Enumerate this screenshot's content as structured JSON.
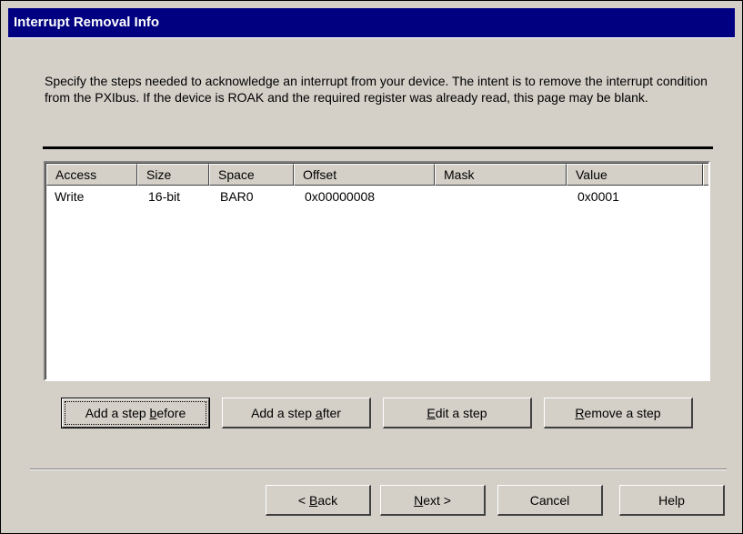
{
  "window": {
    "title": "Interrupt Removal Info"
  },
  "instructions": "Specify the steps needed to acknowledge an interrupt from your device.  The intent is to remove the interrupt condition from the PXIbus.  If the device is ROAK and the required register was already read, this page may be blank.",
  "table": {
    "columns": [
      "Access",
      "Size",
      "Space",
      "Offset",
      "Mask",
      "Value"
    ],
    "rows": [
      [
        "Write",
        "16-bit",
        "BAR0",
        "0x00000008",
        "",
        "0x0001"
      ]
    ]
  },
  "step_buttons": {
    "add_before": {
      "pre": "Add a step ",
      "mnemonic": "b",
      "post": "efore"
    },
    "add_after": {
      "pre": "Add a step ",
      "mnemonic": "a",
      "post": "fter"
    },
    "edit": {
      "pre": "",
      "mnemonic": "E",
      "post": "dit a step"
    },
    "remove": {
      "pre": "",
      "mnemonic": "R",
      "post": "emove a step"
    }
  },
  "nav_buttons": {
    "back": {
      "pre": "< ",
      "mnemonic": "B",
      "post": "ack"
    },
    "next": {
      "pre": "",
      "mnemonic": "N",
      "post": "ext >"
    },
    "cancel": "Cancel",
    "help": "Help"
  },
  "colors": {
    "titlebar": "#000080",
    "dialog_face": "#d4d0c8",
    "list_background": "#ffffff"
  }
}
